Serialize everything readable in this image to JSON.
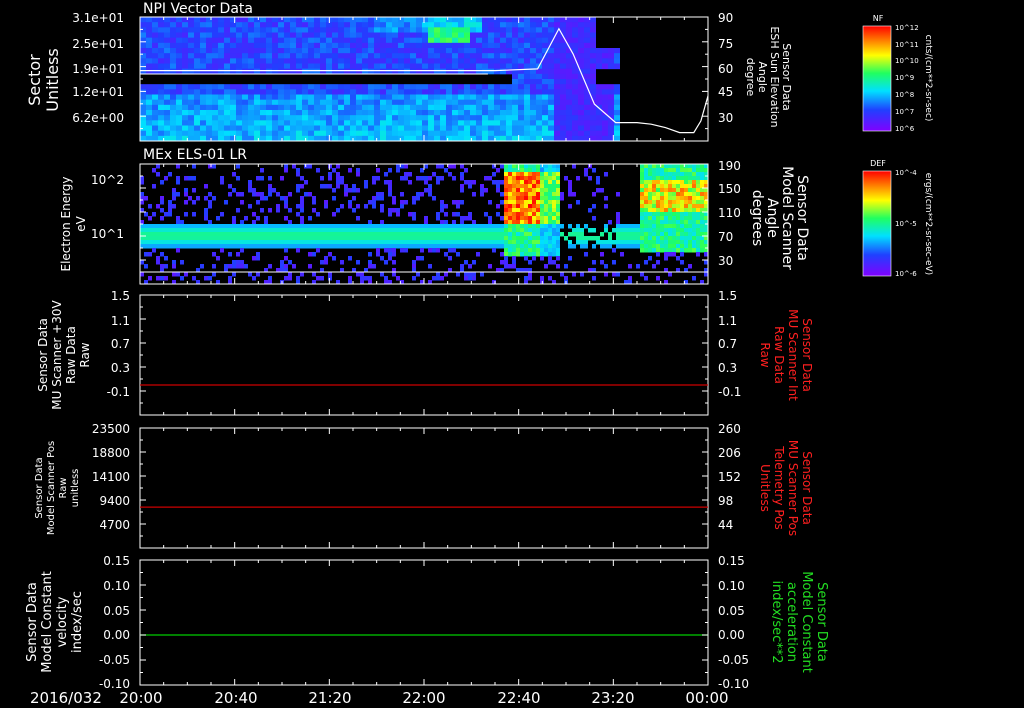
{
  "colors": {
    "background": "#000000",
    "axis": "#ffffff",
    "red_line": "#cc0000",
    "green_line": "#00cc00",
    "red_label": "#ff2020",
    "green_label": "#22dd22"
  },
  "time_axis": {
    "date_label": "2016/032",
    "ticks": [
      "20:00",
      "20:40",
      "21:20",
      "22:00",
      "22:40",
      "23:20",
      "00:00"
    ]
  },
  "chart_data": [
    {
      "type": "heatmap",
      "title": "NPI Vector Data",
      "left_label": [
        "Sector",
        "Unitless"
      ],
      "left_ticks": [
        "3.1e+01",
        "2.5e+01",
        "1.9e+01",
        "1.2e+01",
        "6.2e+00"
      ],
      "right_label": [
        "Sensor Data",
        "ESH Sun Elevation",
        "Angle",
        "degree"
      ],
      "right_ticks": [
        "90",
        "75",
        "60",
        "45",
        "30"
      ],
      "right_ylim": [
        16,
        90
      ],
      "colorbar": {
        "name": "NF",
        "unit": "cnts/(cm**2-sr-sec)",
        "ticks": [
          "10^12",
          "10^11",
          "10^10",
          "10^9",
          "10^8",
          "10^7",
          "10^6"
        ]
      },
      "overlay_line": {
        "name": "ESH Sun Elevation Angle",
        "x_hours": [
          20.0,
          21.0,
          22.0,
          22.5,
          22.8,
          22.95,
          23.05,
          23.2,
          23.35,
          23.5,
          23.6,
          23.7,
          23.8,
          23.9,
          23.95,
          24.0
        ],
        "values": [
          58,
          58,
          58,
          58,
          59,
          83,
          68,
          38,
          27,
          27,
          26,
          24,
          21,
          21,
          28,
          43
        ]
      }
    },
    {
      "type": "heatmap",
      "title": "MEx ELS-01 LR",
      "left_label": [
        "Electron Energy",
        "eV"
      ],
      "left_ticks": [
        "10^2",
        "10^1"
      ],
      "right_label": [
        "Sensor Data",
        "Model Scanner",
        "Angle",
        "degrees"
      ],
      "right_ticks": [
        "190",
        "150",
        "110",
        "70",
        "30"
      ],
      "colorbar": {
        "name": "DEF",
        "unit": "ergs/(cm**2-sr-sec-eV)",
        "ticks": [
          "10^-4",
          "10^-5",
          "10^-6"
        ]
      }
    },
    {
      "type": "line",
      "left_label": [
        "Sensor Data",
        "MU Scanner +30V",
        "Raw Data",
        "Raw"
      ],
      "left_ticks": [
        "1.5",
        "1.1",
        "0.7",
        "0.3",
        "-0.1"
      ],
      "right_label": [
        "Sensor Data",
        "MU Scanner Int",
        "Raw Data",
        "Raw"
      ],
      "right_ticks": [
        "1.5",
        "1.1",
        "0.7",
        "0.3",
        "-0.1"
      ],
      "ylim": [
        -0.5,
        1.5
      ],
      "series": [
        {
          "values_constant": 0.0
        }
      ]
    },
    {
      "type": "line",
      "left_label": [
        "Sensor Data",
        "Model Scanner Pos",
        "Raw",
        "unitless"
      ],
      "left_ticks": [
        "23500",
        "18800",
        "14100",
        "9400",
        "4700"
      ],
      "right_label": [
        "Sensor Data",
        "MU Scanner Pos",
        "Telemetry Pos",
        "Unitless"
      ],
      "right_ticks": [
        "260",
        "206",
        "152",
        "98",
        "44"
      ],
      "ylim": [
        0,
        23500
      ],
      "series": [
        {
          "values_constant": 8000
        }
      ]
    },
    {
      "type": "line",
      "left_label": [
        "Sensor Data",
        "Model Constant",
        "velocity",
        "index/sec"
      ],
      "left_ticks": [
        "0.15",
        "0.10",
        "0.05",
        "0.00",
        "-0.05",
        "-0.10"
      ],
      "right_label": [
        "Sensor Data",
        "Model Constant",
        "acceleration",
        "index/sec**2"
      ],
      "right_ticks": [
        "0.15",
        "0.10",
        "0.05",
        "0.00",
        "-0.05",
        "-0.10"
      ],
      "ylim": [
        -0.1,
        0.15
      ],
      "series": [
        {
          "values_constant": 0.0
        }
      ]
    }
  ]
}
